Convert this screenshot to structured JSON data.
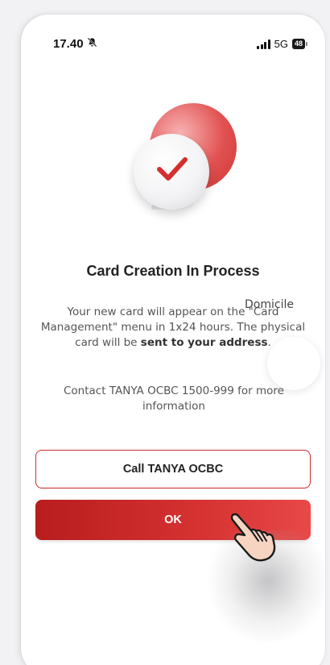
{
  "status_bar": {
    "time": "17.40",
    "network": "5G",
    "battery": "48",
    "icons": [
      "bell-muted-icon",
      "signal-icon",
      "battery-icon"
    ]
  },
  "dialog": {
    "title": "Card Creation In Process",
    "body_part1": "Your new card will appear on the \"Card Management\" menu in 1x24 hours. The physical card will be ",
    "body_bold": "sent to your address",
    "body_part2": ".",
    "contact": "Contact TANYA OCBC 1500-999 for more information",
    "hero_icon": "check-circle-icon"
  },
  "overlay": {
    "label": "Domicile"
  },
  "buttons": {
    "call": "Call TANYA OCBC",
    "ok": "OK"
  },
  "colors": {
    "accent": "#d42f2f",
    "accent_dark": "#b81d1d",
    "text": "#222222",
    "muted": "#555555"
  }
}
